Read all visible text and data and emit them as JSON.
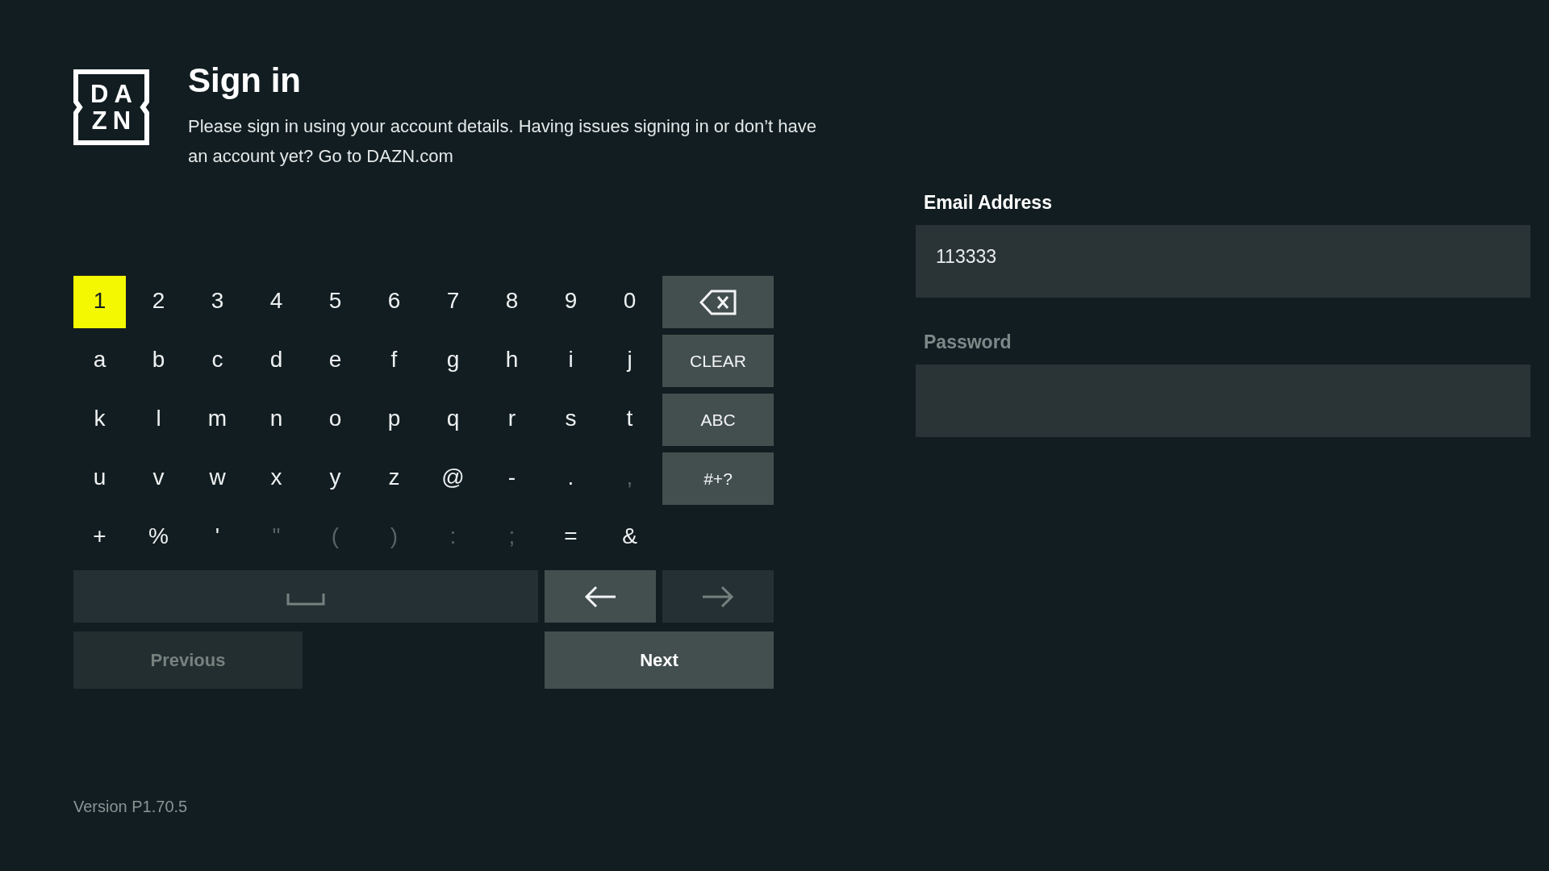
{
  "logo": [
    "DA",
    "ZN"
  ],
  "title": "Sign in",
  "description": "Please sign in using your account details. Having issues signing in or don’t have an account yet? Go to DAZN.com",
  "keyboard": {
    "rows": [
      {
        "keys": [
          {
            "label": "1",
            "selected": true,
            "disabled": false
          },
          {
            "label": "2",
            "selected": false,
            "disabled": false
          },
          {
            "label": "3",
            "selected": false,
            "disabled": false
          },
          {
            "label": "4",
            "selected": false,
            "disabled": false
          },
          {
            "label": "5",
            "selected": false,
            "disabled": false
          },
          {
            "label": "6",
            "selected": false,
            "disabled": false
          },
          {
            "label": "7",
            "selected": false,
            "disabled": false
          },
          {
            "label": "8",
            "selected": false,
            "disabled": false
          },
          {
            "label": "9",
            "selected": false,
            "disabled": false
          },
          {
            "label": "0",
            "selected": false,
            "disabled": false
          }
        ],
        "side_key": {
          "kind": "backspace",
          "selected": false,
          "disabled": false
        }
      },
      {
        "keys": [
          {
            "label": "a",
            "selected": false,
            "disabled": false
          },
          {
            "label": "b",
            "selected": false,
            "disabled": false
          },
          {
            "label": "c",
            "selected": false,
            "disabled": false
          },
          {
            "label": "d",
            "selected": false,
            "disabled": false
          },
          {
            "label": "e",
            "selected": false,
            "disabled": false
          },
          {
            "label": "f",
            "selected": false,
            "disabled": false
          },
          {
            "label": "g",
            "selected": false,
            "disabled": false
          },
          {
            "label": "h",
            "selected": false,
            "disabled": false
          },
          {
            "label": "i",
            "selected": false,
            "disabled": false
          },
          {
            "label": "j",
            "selected": false,
            "disabled": false
          }
        ],
        "side_key": {
          "kind": "text",
          "label": "CLEAR",
          "selected": false,
          "disabled": false
        }
      },
      {
        "keys": [
          {
            "label": "k",
            "selected": false,
            "disabled": false
          },
          {
            "label": "l",
            "selected": false,
            "disabled": false
          },
          {
            "label": "m",
            "selected": false,
            "disabled": false
          },
          {
            "label": "n",
            "selected": false,
            "disabled": false
          },
          {
            "label": "o",
            "selected": false,
            "disabled": false
          },
          {
            "label": "p",
            "selected": false,
            "disabled": false
          },
          {
            "label": "q",
            "selected": false,
            "disabled": false
          },
          {
            "label": "r",
            "selected": false,
            "disabled": false
          },
          {
            "label": "s",
            "selected": false,
            "disabled": false
          },
          {
            "label": "t",
            "selected": false,
            "disabled": false
          }
        ],
        "side_key": {
          "kind": "text",
          "label": "ABC",
          "selected": false,
          "disabled": false
        }
      },
      {
        "keys": [
          {
            "label": "u",
            "selected": false,
            "disabled": false
          },
          {
            "label": "v",
            "selected": false,
            "disabled": false
          },
          {
            "label": "w",
            "selected": false,
            "disabled": false
          },
          {
            "label": "x",
            "selected": false,
            "disabled": false
          },
          {
            "label": "y",
            "selected": false,
            "disabled": false
          },
          {
            "label": "z",
            "selected": false,
            "disabled": false
          },
          {
            "label": "@",
            "selected": false,
            "disabled": false
          },
          {
            "label": "-",
            "selected": false,
            "disabled": false
          },
          {
            "label": ".",
            "selected": false,
            "disabled": false
          },
          {
            "label": ",",
            "selected": false,
            "disabled": true
          }
        ],
        "side_key": {
          "kind": "text",
          "label": "#+?",
          "selected": false,
          "disabled": false
        }
      },
      {
        "keys": [
          {
            "label": "+",
            "selected": false,
            "disabled": false
          },
          {
            "label": "%",
            "selected": false,
            "disabled": false
          },
          {
            "label": "'",
            "selected": false,
            "disabled": false
          },
          {
            "label": "\"",
            "selected": false,
            "disabled": true
          },
          {
            "label": "(",
            "selected": false,
            "disabled": true
          },
          {
            "label": ")",
            "selected": false,
            "disabled": true
          },
          {
            "label": ":",
            "selected": false,
            "disabled": true
          },
          {
            "label": ";",
            "selected": false,
            "disabled": true
          },
          {
            "label": "=",
            "selected": false,
            "disabled": false
          },
          {
            "label": "&",
            "selected": false,
            "disabled": false
          }
        ]
      }
    ],
    "space_key": {
      "selected": false,
      "disabled": true
    },
    "cursor_keys": [
      {
        "kind": "left",
        "selected": false,
        "disabled": false
      },
      {
        "kind": "right",
        "selected": false,
        "disabled": true
      }
    ]
  },
  "nav_buttons": [
    {
      "label": "Previous",
      "selected": false,
      "disabled": true
    },
    {
      "label": "Next",
      "selected": false,
      "disabled": false
    }
  ],
  "version": "Version P1.70.5",
  "fields": [
    {
      "label": "Email Address",
      "value": "113333",
      "selected": true
    },
    {
      "label": "Password",
      "selected": false
    }
  ]
}
